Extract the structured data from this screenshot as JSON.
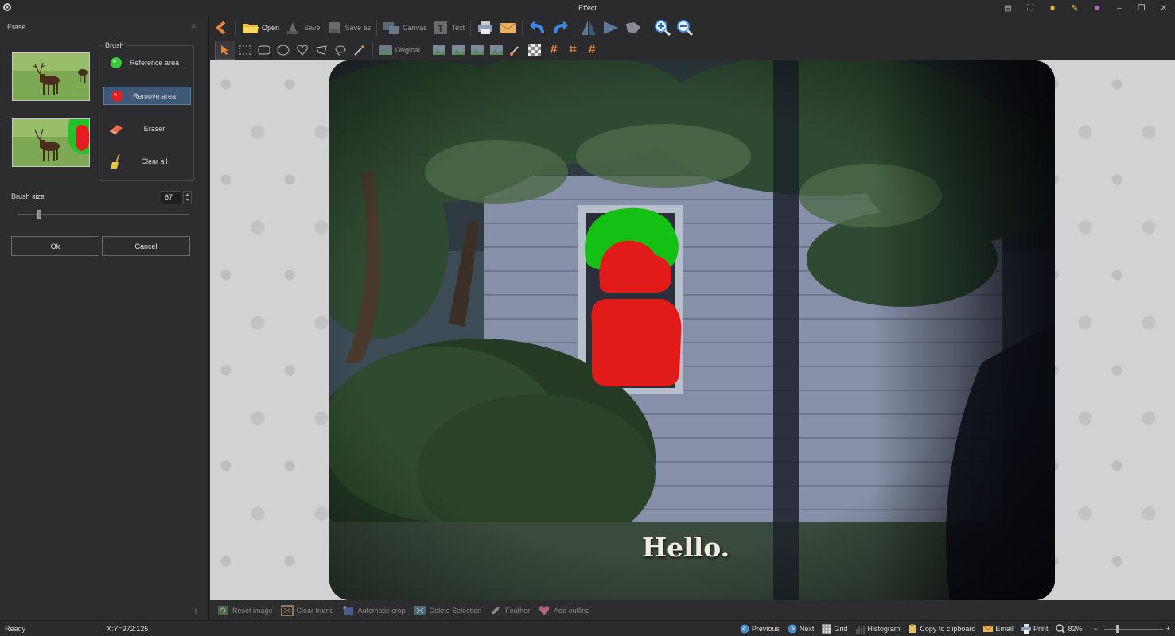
{
  "window": {
    "title": "Effect",
    "controls": [
      "minimize",
      "restore",
      "close"
    ]
  },
  "erase_panel": {
    "title": "Erase",
    "brush_group_label": "Brush",
    "brush_buttons": [
      {
        "label": "Reference area",
        "icon": "green-circle-icon",
        "active": false
      },
      {
        "label": "Remove area",
        "icon": "red-circle-icon",
        "active": true
      },
      {
        "label": "Eraser",
        "icon": "eraser-icon",
        "active": false
      },
      {
        "label": "Clear all",
        "icon": "broom-icon",
        "active": false
      }
    ],
    "brush_size_label": "Brush size",
    "brush_size_value": "67",
    "ok_label": "Ok",
    "cancel_label": "Cancel"
  },
  "toolbar": {
    "open": "Open",
    "save": "Save",
    "save_as": "Save as",
    "canvas": "Canvas",
    "text": "Text",
    "original": "Original"
  },
  "photo": {
    "caption": "Hello."
  },
  "actions": {
    "reset_image": "Reset image",
    "clear_frame": "Clear frame",
    "automatic_crop": "Automatic crop",
    "delete_selection": "Delete Selection",
    "feather": "Feather",
    "add_outline": "Add outline"
  },
  "status": {
    "ready": "Ready",
    "coords": "X:Y=972:125",
    "previous": "Previous",
    "next": "Next",
    "grid": "Grid",
    "histogram": "Histogram",
    "copy": "Copy to clipboard",
    "email": "Email",
    "print": "Print",
    "zoom": "82%",
    "zoom_minus": "−",
    "zoom_plus": "+"
  },
  "colors": {
    "accent": "#3e5877",
    "reference": "#22b422",
    "remove": "#e41e1e"
  }
}
